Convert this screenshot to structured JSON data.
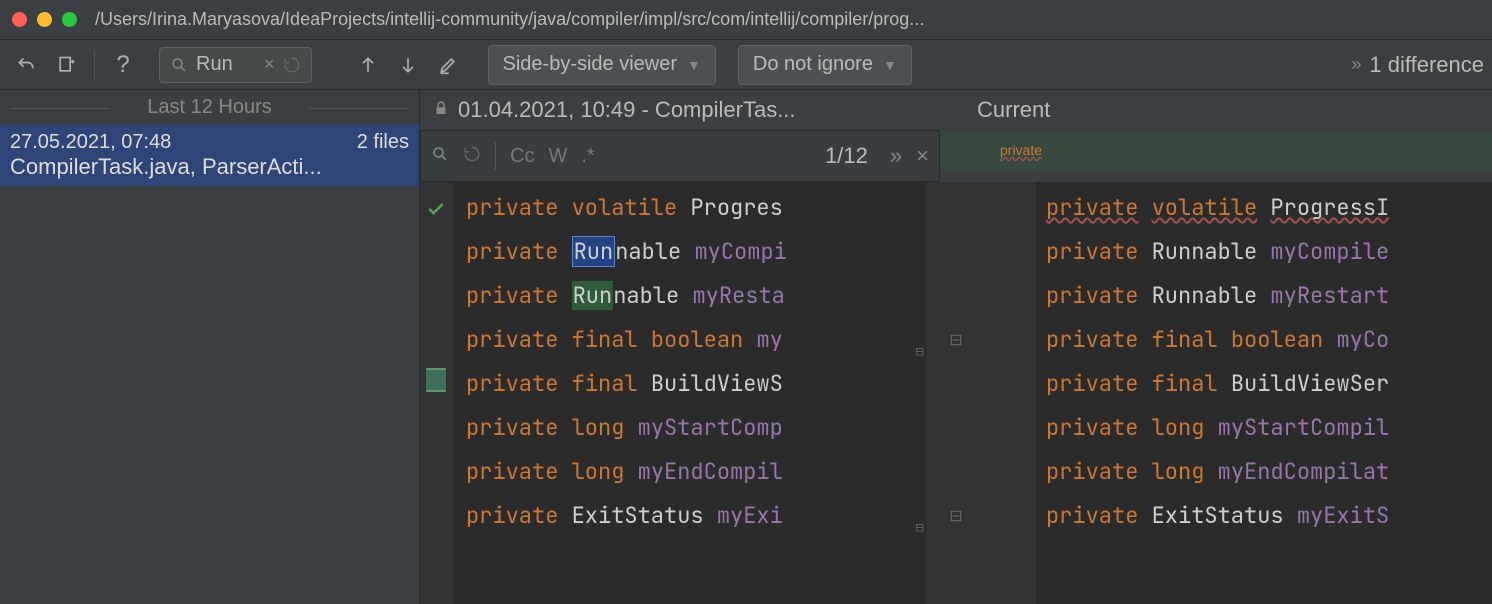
{
  "window": {
    "path": "/Users/Irina.Maryasova/IdeaProjects/intellij-community/java/compiler/impl/src/com/intellij/compiler/prog..."
  },
  "toolbar": {
    "search_value": "Run",
    "viewer_mode": "Side-by-side viewer",
    "ignore_mode": "Do not ignore",
    "diff_count": "1 difference",
    "more_glyph": "»"
  },
  "sidebar": {
    "header": "Last 12 Hours",
    "items": [
      {
        "timestamp": "27.05.2021, 07:48",
        "files_count": "2 files",
        "files": "CompilerTask.java, ParserActi..."
      }
    ]
  },
  "diff": {
    "left_title": "01.04.2021, 10:49 - CompilerTas...",
    "right_title": "Current",
    "find": {
      "count": "1/12",
      "more": "»"
    },
    "right_top_added": "private",
    "left_lines": [
      {
        "t": [
          [
            "kw",
            "private"
          ],
          [
            "sp",
            " "
          ],
          [
            "kw",
            "volatile"
          ],
          [
            "sp",
            " "
          ],
          [
            "typ",
            "Progres"
          ]
        ]
      },
      {
        "t": [
          [
            "kw",
            "private"
          ],
          [
            "sp",
            " "
          ],
          [
            "hlb",
            "Run"
          ],
          [
            "typ",
            "nable"
          ],
          [
            "sp",
            " "
          ],
          [
            "ident",
            "myCompi"
          ]
        ]
      },
      {
        "t": [
          [
            "kw",
            "private"
          ],
          [
            "sp",
            " "
          ],
          [
            "hlg",
            "Run"
          ],
          [
            "typ",
            "nable"
          ],
          [
            "sp",
            " "
          ],
          [
            "ident",
            "myResta"
          ]
        ]
      },
      {
        "t": [
          [
            "kw",
            "private"
          ],
          [
            "sp",
            " "
          ],
          [
            "kw",
            "final"
          ],
          [
            "sp",
            " "
          ],
          [
            "kw",
            "boolean"
          ],
          [
            "sp",
            " "
          ],
          [
            "ident",
            "my"
          ]
        ]
      },
      {
        "t": [
          [
            "kw",
            "private"
          ],
          [
            "sp",
            " "
          ],
          [
            "kw",
            "final"
          ],
          [
            "sp",
            " "
          ],
          [
            "typ",
            "BuildViewS"
          ]
        ]
      },
      {
        "t": [
          [
            "kw",
            "private"
          ],
          [
            "sp",
            " "
          ],
          [
            "kw",
            "long"
          ],
          [
            "sp",
            " "
          ],
          [
            "ident",
            "myStartComp"
          ]
        ]
      },
      {
        "t": [
          [
            "kw",
            "private"
          ],
          [
            "sp",
            " "
          ],
          [
            "kw",
            "long"
          ],
          [
            "sp",
            " "
          ],
          [
            "ident",
            "myEndCompil"
          ]
        ]
      },
      {
        "t": [
          [
            "kw",
            "private"
          ],
          [
            "sp",
            " "
          ],
          [
            "typ",
            "ExitStatus"
          ],
          [
            "sp",
            " "
          ],
          [
            "ident",
            "myExi"
          ]
        ]
      }
    ],
    "right_lines": [
      {
        "t": [
          [
            "kwe",
            "private"
          ],
          [
            "sp",
            " "
          ],
          [
            "kwe",
            "volatile"
          ],
          [
            "sp",
            " "
          ],
          [
            "type",
            "ProgressI"
          ]
        ]
      },
      {
        "t": [
          [
            "kw",
            "private"
          ],
          [
            "sp",
            " "
          ],
          [
            "typ",
            "Runnable"
          ],
          [
            "sp",
            " "
          ],
          [
            "ident",
            "myCompile"
          ]
        ]
      },
      {
        "t": [
          [
            "kw",
            "private"
          ],
          [
            "sp",
            " "
          ],
          [
            "typ",
            "Runnable"
          ],
          [
            "sp",
            " "
          ],
          [
            "ident",
            "myRestart"
          ]
        ]
      },
      {
        "t": [
          [
            "kw",
            "private"
          ],
          [
            "sp",
            " "
          ],
          [
            "kw",
            "final"
          ],
          [
            "sp",
            " "
          ],
          [
            "kw",
            "boolean"
          ],
          [
            "sp",
            " "
          ],
          [
            "ident",
            "myCo"
          ]
        ]
      },
      {
        "t": [
          [
            "kw",
            "private"
          ],
          [
            "sp",
            " "
          ],
          [
            "kw",
            "final"
          ],
          [
            "sp",
            " "
          ],
          [
            "typ",
            "BuildViewSer"
          ]
        ]
      },
      {
        "t": [
          [
            "kw",
            "private"
          ],
          [
            "sp",
            " "
          ],
          [
            "kw",
            "long"
          ],
          [
            "sp",
            " "
          ],
          [
            "ident",
            "myStartCompil"
          ]
        ]
      },
      {
        "t": [
          [
            "kw",
            "private"
          ],
          [
            "sp",
            " "
          ],
          [
            "kw",
            "long"
          ],
          [
            "sp",
            " "
          ],
          [
            "ident",
            "myEndCompilat"
          ]
        ]
      },
      {
        "t": [
          [
            "kw",
            "private"
          ],
          [
            "sp",
            " "
          ],
          [
            "typ",
            "ExitStatus"
          ],
          [
            "sp",
            " "
          ],
          [
            "ident",
            "myExitS"
          ]
        ]
      }
    ]
  }
}
